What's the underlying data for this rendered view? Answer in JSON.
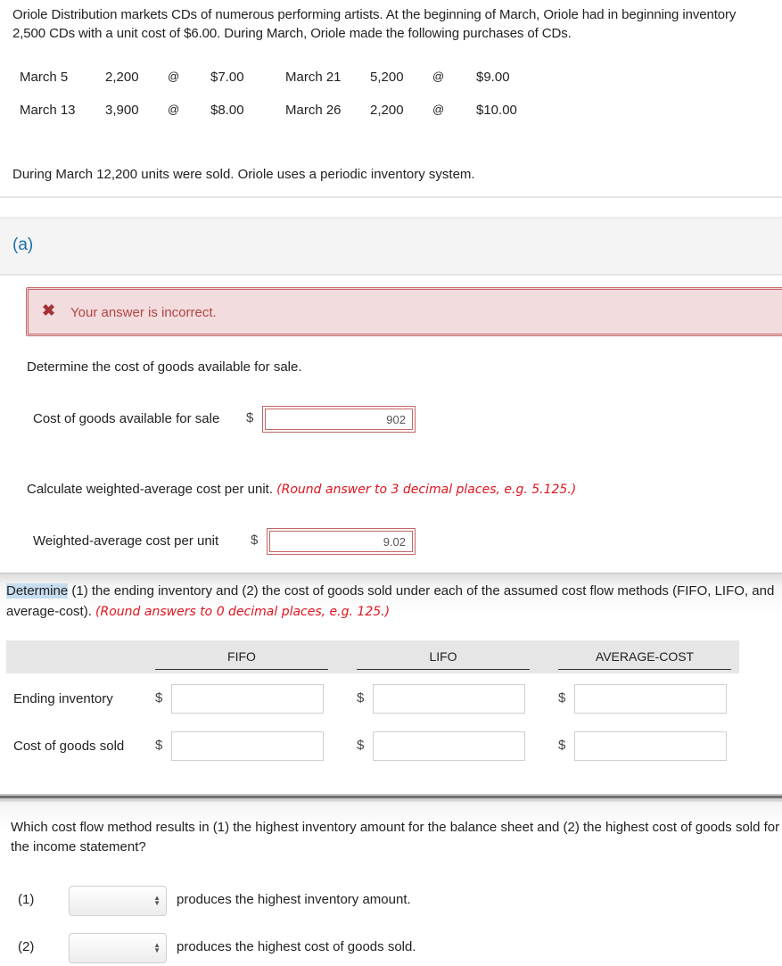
{
  "problem": {
    "intro": "Oriole Distribution markets CDs of numerous performing artists. At the beginning of March, Oriole had in beginning inventory 2,500 CDs with a unit cost of $6.00. During March, Oriole made the following purchases of CDs.",
    "purchases": [
      {
        "date": "March 5",
        "units": "2,200",
        "at": "@",
        "cost": "$7.00"
      },
      {
        "date": "March 13",
        "units": "3,900",
        "at": "@",
        "cost": "$8.00"
      },
      {
        "date": "March 21",
        "units": "5,200",
        "at": "@",
        "cost": "$9.00"
      },
      {
        "date": "March 26",
        "units": "2,200",
        "at": "@",
        "cost": "$10.00"
      }
    ],
    "sold_text": "During March 12,200 units were sold. Oriole uses a periodic inventory system."
  },
  "part_a": {
    "label": "(a)",
    "error_icon": "x-mark-icon",
    "error_text": "Your answer is incorrect.",
    "q1": {
      "prompt": "Determine the cost of goods available for sale.",
      "field_label": "Cost of goods available for sale",
      "currency": "$",
      "value": "902"
    },
    "q2": {
      "prompt": "Calculate weighted-average cost per unit.",
      "hint": "(Round answer to 3 decimal places, e.g. 5.125.)",
      "field_label": "Weighted-average cost per unit",
      "currency": "$",
      "value": "9.02"
    }
  },
  "part_b": {
    "prompt_highlight": "Determine",
    "prompt_line1_rest": " (1) the ending inventory and (2) the cost of goods sold under each of the assumed cost flow methods (FIFO, LIFO, and",
    "prompt_line2": "average-cost).",
    "hint": "(Round answers to 0 decimal places, e.g. 125.)",
    "columns": [
      "FIFO",
      "LIFO",
      "AVERAGE-COST"
    ],
    "rows": [
      {
        "label": "Ending inventory",
        "currency": "$",
        "values": [
          "",
          "",
          ""
        ]
      },
      {
        "label": "Cost of goods sold",
        "currency": "$",
        "values": [
          "",
          "",
          ""
        ]
      }
    ]
  },
  "part_c": {
    "prompt_line1": "Which cost flow method results in (1) the highest inventory amount for the balance sheet and (2) the highest cost of goods sold for",
    "prompt_line2": "the income statement?",
    "items": [
      {
        "number": "(1)",
        "selected": "",
        "text": "produces the highest inventory amount."
      },
      {
        "number": "(2)",
        "selected": "",
        "text": "produces the highest cost of goods sold."
      }
    ]
  },
  "colors": {
    "error_bg": "#f3dcde",
    "error_border": "#c46666",
    "hint_red": "#e0141e",
    "part_label_blue": "#1a6fa8"
  }
}
